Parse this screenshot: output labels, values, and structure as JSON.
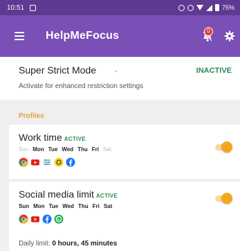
{
  "status_bar": {
    "time": "10:51",
    "battery": "75%"
  },
  "app_bar": {
    "title": "HelpMeFocus",
    "notification_count": "0"
  },
  "strict_mode": {
    "title": "Super Strict Mode",
    "status": "INACTIVE",
    "description": "Activate for enhanced restriction settings"
  },
  "profiles_label": "Profiles",
  "profiles": [
    {
      "name": "Work time",
      "state": "ACTIVE",
      "days": [
        "Sun",
        "Mon",
        "Tue",
        "Wed",
        "Thu",
        "Fri",
        "Sat"
      ],
      "days_active": [
        false,
        true,
        true,
        true,
        true,
        true,
        false
      ],
      "apps": [
        "chrome-icon",
        "youtube-icon",
        "sliders-app-icon",
        "snapchat-icon",
        "facebook-icon"
      ],
      "enabled": true
    },
    {
      "name": "Social media limit",
      "state": "ACTIVE",
      "days": [
        "Sun",
        "Mon",
        "Tue",
        "Wed",
        "Thu",
        "Fri",
        "Sat"
      ],
      "days_active": [
        true,
        true,
        true,
        true,
        true,
        true,
        true
      ],
      "apps": [
        "chrome-icon",
        "youtube-icon",
        "facebook-icon",
        "whatsapp-icon"
      ],
      "daily_limit_label": "Daily limit:",
      "daily_limit_value": "0 hours, 45 minutes",
      "enabled": true
    }
  ],
  "colors": {
    "status_bar": "#5e3a92",
    "app_bar": "#7a4fb6",
    "active_green": "#2a8a52",
    "accent_orange": "#f2a81d",
    "section_label": "#d9a43a"
  }
}
